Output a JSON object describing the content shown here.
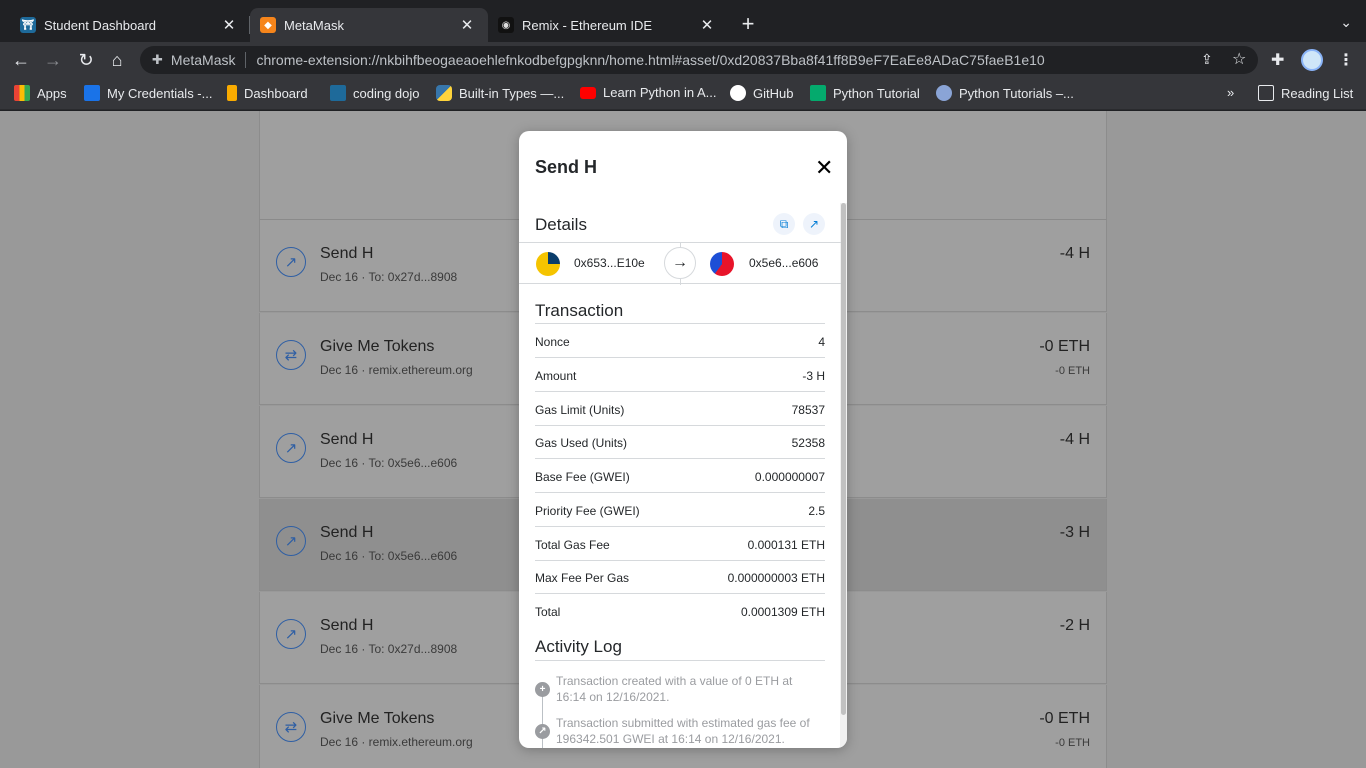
{
  "tabs": [
    {
      "title": "Student Dashboard",
      "favicon": "coding-dojo-icon",
      "color": "#1e6a9a"
    },
    {
      "title": "MetaMask",
      "favicon": "metamask-fox-icon",
      "color": "#f6851b"
    },
    {
      "title": "Remix - Ethereum IDE",
      "favicon": "remix-icon",
      "color": "#111111"
    }
  ],
  "toolbar": {
    "extension_name": "MetaMask",
    "url": "chrome-extension://nkbihfbeogaeaoehlefnkodbefgpgknn/home.html#asset/0xd20837Bba8f41ff8B9eF7EaEe8ADaC75faeB1e10"
  },
  "bookmarks": [
    {
      "label": "Apps",
      "color": "#ea4335"
    },
    {
      "label": "My Credentials -...",
      "color": "#1a73e8"
    },
    {
      "label": "Dashboard",
      "color": "#f9ab00"
    },
    {
      "label": "coding dojo",
      "color": "#1e6a9a"
    },
    {
      "label": "Built-in Types —...",
      "color": "#3776ab"
    },
    {
      "label": "Learn Python in A...",
      "color": "#ff0000"
    },
    {
      "label": "GitHub",
      "color": "#ffffff"
    },
    {
      "label": "Python Tutorial",
      "color": "#04aa6d"
    },
    {
      "label": "Python Tutorials –...",
      "color": "#8aa4d6"
    }
  ],
  "reading_list": "Reading List",
  "activity": [
    {
      "icon": "send-icon",
      "title": "Send H",
      "subtitle": "Dec 16 · To: 0x27d...8908",
      "amount": "-4 H",
      "amount2": ""
    },
    {
      "icon": "swap-icon",
      "title": "Give Me Tokens",
      "subtitle": "Dec 16 · remix.ethereum.org",
      "amount": "-0 ETH",
      "amount2": "-0 ETH"
    },
    {
      "icon": "send-icon",
      "title": "Send H",
      "subtitle": "Dec 16 · To: 0x5e6...e606",
      "amount": "-4 H",
      "amount2": ""
    },
    {
      "icon": "send-icon",
      "title": "Send H",
      "subtitle": "Dec 16 · To: 0x5e6...e606",
      "amount": "-3 H",
      "amount2": ""
    },
    {
      "icon": "send-icon",
      "title": "Send H",
      "subtitle": "Dec 16 · To: 0x27d...8908",
      "amount": "-2 H",
      "amount2": ""
    },
    {
      "icon": "swap-icon",
      "title": "Give Me Tokens",
      "subtitle": "Dec 16 · remix.ethereum.org",
      "amount": "-0 ETH",
      "amount2": "-0 ETH"
    }
  ],
  "modal": {
    "title": "Send H",
    "details_label": "Details",
    "from_address": "0x653...E10e",
    "to_address": "0x5e6...e606",
    "transaction_label": "Transaction",
    "transaction": [
      {
        "key": "Nonce",
        "value": "4"
      },
      {
        "key": "Amount",
        "value": "-3 H"
      },
      {
        "key": "Gas Limit (Units)",
        "value": "78537"
      },
      {
        "key": "Gas Used (Units)",
        "value": "52358"
      },
      {
        "key": "Base Fee (GWEI)",
        "value": "0.000000007"
      },
      {
        "key": "Priority Fee (GWEI)",
        "value": "2.5"
      },
      {
        "key": "Total Gas Fee",
        "value": "0.000131 ETH"
      },
      {
        "key": "Max Fee Per Gas",
        "value": "0.000000003 ETH"
      },
      {
        "key": "Total",
        "value": "0.0001309 ETH"
      }
    ],
    "activity_log_label": "Activity Log",
    "activity_log": [
      {
        "icon": "plus-icon",
        "text": "Transaction created with a value of 0 ETH at 16:14 on 12/16/2021."
      },
      {
        "icon": "arrow-up-right-icon",
        "text": "Transaction submitted with estimated gas fee of 196342.501 GWEI at 16:14 on 12/16/2021."
      }
    ]
  }
}
